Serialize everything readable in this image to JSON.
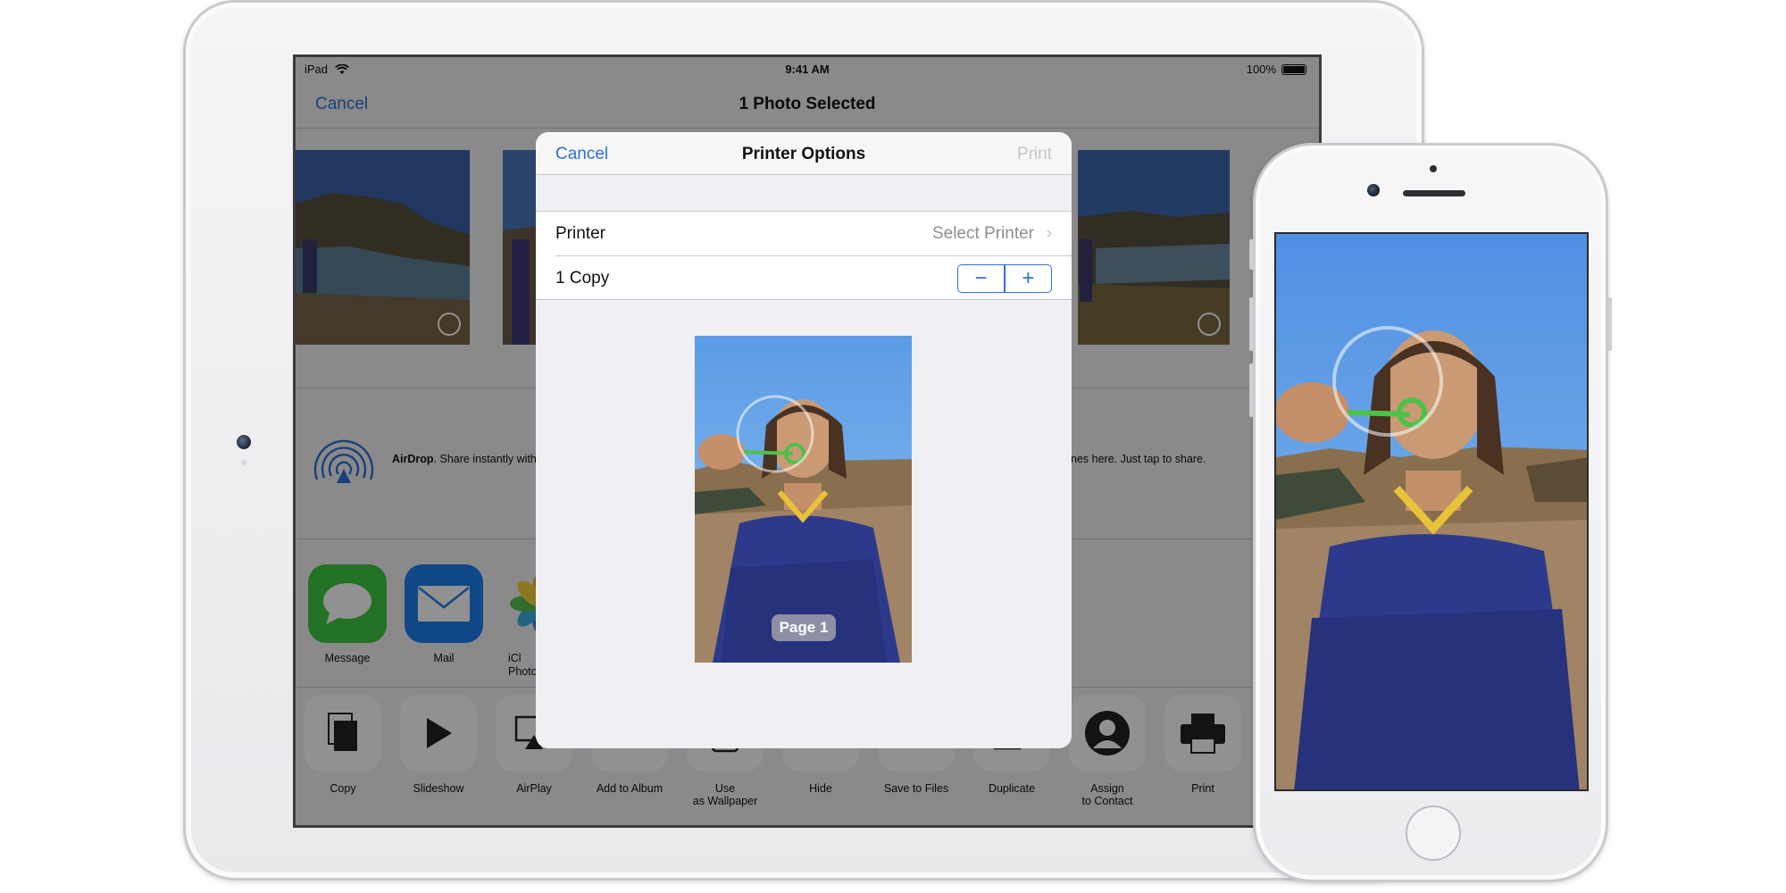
{
  "ipad": {
    "status_bar": {
      "device": "iPad",
      "time": "9:41 AM",
      "battery": "100%"
    },
    "nav": {
      "cancel": "Cancel",
      "title": "1 Photo Selected"
    },
    "airdrop": {
      "title": "AirDrop",
      "text_left": ". Share instantly with p",
      "text_right": "nes here. Just tap to share."
    },
    "share_apps": [
      {
        "label": "Message",
        "icon": "message-icon",
        "color": "#3ec944"
      },
      {
        "label": "Mail",
        "icon": "mail-icon",
        "color": "#1e7ff0"
      },
      {
        "label_line1": "iCl",
        "label_line2": "Photo",
        "icon": "photos-icon"
      }
    ],
    "actions": [
      {
        "label": "Copy",
        "icon": "copy-icon"
      },
      {
        "label": "Slideshow",
        "icon": "slideshow-icon"
      },
      {
        "label": "AirPlay",
        "icon": "airplay-icon"
      },
      {
        "label": "Add to Album",
        "icon": "add-to-album-icon"
      },
      {
        "label_line1": "Use",
        "label_line2": "as Wallpaper",
        "icon": "wallpaper-icon"
      },
      {
        "label": "Hide",
        "icon": "hide-icon"
      },
      {
        "label": "Save to Files",
        "icon": "save-to-files-icon"
      },
      {
        "label": "Duplicate",
        "icon": "duplicate-icon"
      },
      {
        "label_line1": "Assign",
        "label_line2": "to Contact",
        "icon": "assign-contact-icon"
      },
      {
        "label": "Print",
        "icon": "print-icon"
      }
    ]
  },
  "printer_options": {
    "cancel": "Cancel",
    "title": "Printer Options",
    "print": "Print",
    "printer_label": "Printer",
    "printer_value": "Select Printer",
    "copies_label": "1 Copy",
    "minus": "−",
    "plus": "+",
    "page_badge": "Page 1"
  },
  "colors": {
    "ios_blue": "#2e6fd8",
    "disabled_gray": "#c4c4c8",
    "secondary_gray": "#8e8e93"
  }
}
